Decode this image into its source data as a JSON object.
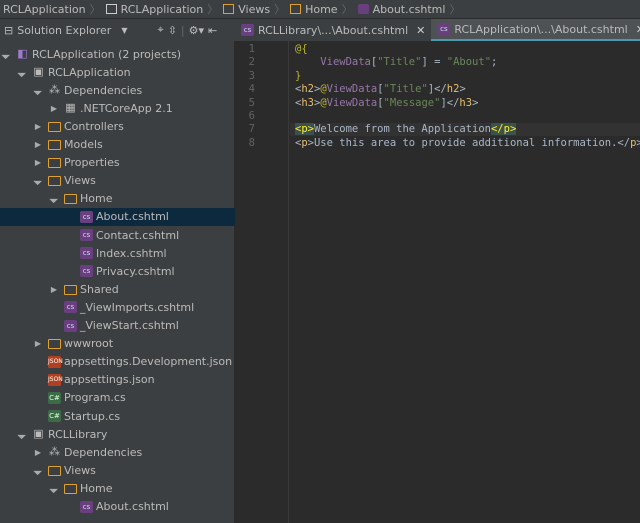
{
  "breadcrumbs": [
    "RCLApplication",
    "RCLApplication",
    "Views",
    "Home",
    "About.cshtml"
  ],
  "panel": {
    "title": "Solution Explorer"
  },
  "tabs": [
    {
      "label": "RCLLibrary\\...\\About.cshtml",
      "active": false
    },
    {
      "label": "RCLApplication\\...\\About.cshtml",
      "active": true
    }
  ],
  "tree": [
    {
      "label": "RCLApplication (2 projects)",
      "level": 0,
      "icon": "solution-icon",
      "expander": "expanded"
    },
    {
      "label": "RCLApplication",
      "level": 1,
      "icon": "project-icon",
      "expander": "expanded"
    },
    {
      "label": "Dependencies",
      "level": 2,
      "icon": "dependencies-icon",
      "expander": "expanded"
    },
    {
      "label": ".NETCoreApp 2.1",
      "level": 3,
      "icon": "framework-icon",
      "expander": "collapsed"
    },
    {
      "label": "Controllers",
      "level": 2,
      "icon": "folder-icon",
      "expander": "collapsed"
    },
    {
      "label": "Models",
      "level": 2,
      "icon": "folder-icon",
      "expander": "collapsed"
    },
    {
      "label": "Properties",
      "level": 2,
      "icon": "folder-icon",
      "expander": "collapsed"
    },
    {
      "label": "Views",
      "level": 2,
      "icon": "folder-icon",
      "expander": "expanded"
    },
    {
      "label": "Home",
      "level": 3,
      "icon": "folder-icon",
      "expander": "expanded"
    },
    {
      "label": "About.cshtml",
      "level": 4,
      "icon": "cshtml-icon",
      "selected": true
    },
    {
      "label": "Contact.cshtml",
      "level": 4,
      "icon": "cshtml-icon"
    },
    {
      "label": "Index.cshtml",
      "level": 4,
      "icon": "cshtml-icon"
    },
    {
      "label": "Privacy.cshtml",
      "level": 4,
      "icon": "cshtml-icon"
    },
    {
      "label": "Shared",
      "level": 3,
      "icon": "folder-icon",
      "expander": "collapsed"
    },
    {
      "label": "_ViewImports.cshtml",
      "level": 3,
      "icon": "cshtml-icon"
    },
    {
      "label": "_ViewStart.cshtml",
      "level": 3,
      "icon": "cshtml-icon"
    },
    {
      "label": "wwwroot",
      "level": 2,
      "icon": "folder-icon",
      "expander": "collapsed"
    },
    {
      "label": "appsettings.Development.json",
      "level": 2,
      "icon": "json-icon"
    },
    {
      "label": "appsettings.json",
      "level": 2,
      "icon": "json-icon"
    },
    {
      "label": "Program.cs",
      "level": 2,
      "icon": "cs-icon"
    },
    {
      "label": "Startup.cs",
      "level": 2,
      "icon": "cs-icon"
    },
    {
      "label": "RCLLibrary",
      "level": 1,
      "icon": "project-icon",
      "expander": "expanded"
    },
    {
      "label": "Dependencies",
      "level": 2,
      "icon": "dependencies-icon",
      "expander": "collapsed"
    },
    {
      "label": "Views",
      "level": 2,
      "icon": "folder-icon",
      "expander": "expanded"
    },
    {
      "label": "Home",
      "level": 3,
      "icon": "folder-icon",
      "expander": "expanded"
    },
    {
      "label": "About.cshtml",
      "level": 4,
      "icon": "cshtml-icon"
    }
  ],
  "code": [
    "@{",
    "    ViewData[\"Title\"] = \"About\";",
    "}",
    "<h2>@ViewData[\"Title\"]</h2>",
    "<h3>@ViewData[\"Message\"]</h3>",
    "",
    "<p>Welcome from the Application</p>",
    "<p>Use this area to provide additional information.</p>"
  ],
  "current_line": 7
}
